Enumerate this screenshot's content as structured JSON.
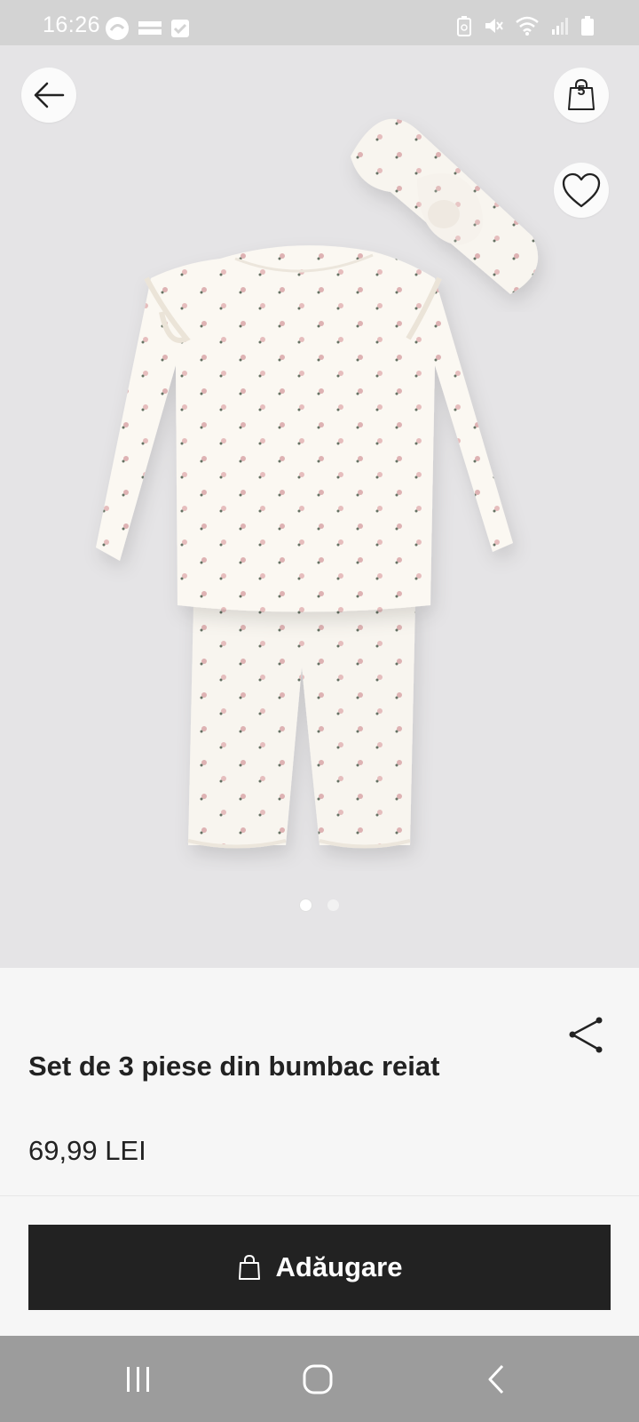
{
  "status_bar": {
    "time": "16:26",
    "icons": [
      "temu-notification-icon",
      "checkbox-notification-icon",
      "battery-saver-icon",
      "mute-icon",
      "wifi-icon",
      "signal-icon",
      "battery-icon"
    ]
  },
  "header": {
    "back_icon": "arrow-left-icon",
    "bag_count": "5",
    "bag_icon": "shopping-bag-icon",
    "favorite_icon": "heart-icon"
  },
  "gallery": {
    "image_count": 2,
    "active_index": 0
  },
  "product": {
    "title": "Set de 3 piese din bumbac reiat",
    "price": "69,99 LEI",
    "share_icon": "share-icon"
  },
  "actions": {
    "add_label": "Adăugare",
    "add_icon": "shopping-bag-icon"
  },
  "nav_bar": {
    "icons": [
      "recents-icon",
      "home-icon",
      "back-icon"
    ]
  },
  "colors": {
    "gallery_bg": "#e5e4e6",
    "panel_bg": "#f6f6f6",
    "button_bg": "#222222",
    "status_bar_bg": "#d3d3d3",
    "nav_bar_bg": "#9c9c9c"
  }
}
